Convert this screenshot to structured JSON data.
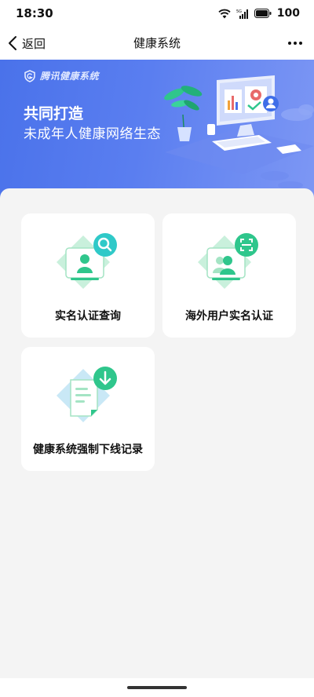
{
  "status_bar": {
    "time": "18:30",
    "battery": "100"
  },
  "navbar": {
    "back_label": "返回",
    "title": "健康系统"
  },
  "banner": {
    "brand": "腾讯健康系统",
    "line1": "共同打造",
    "line2": "未成年人健康网络生态"
  },
  "cards": [
    {
      "label": "实名认证查询",
      "icon": "id-search-icon"
    },
    {
      "label": "海外用户实名认证",
      "icon": "scan-user-icon"
    },
    {
      "label": "健康系统强制下线记录",
      "icon": "download-document-icon"
    }
  ],
  "colors": {
    "banner_start": "#4a72ea",
    "banner_end": "#7d97f4",
    "accent_green": "#2fc68c"
  }
}
